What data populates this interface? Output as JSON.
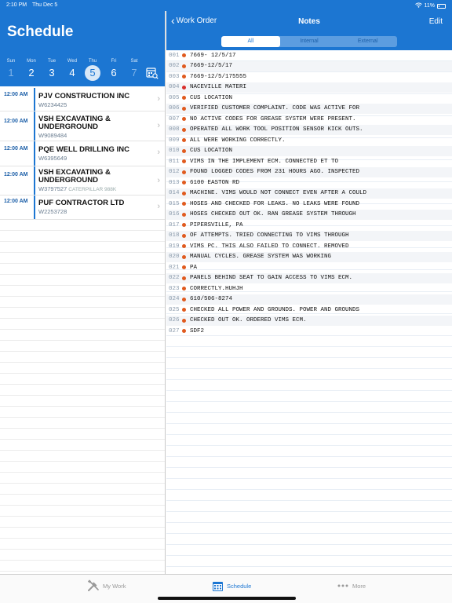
{
  "status_bar": {
    "time": "2:10 PM",
    "date": "Thu Dec 5",
    "battery": "11%"
  },
  "schedule": {
    "title": "Schedule",
    "week": {
      "days": [
        "Sun",
        "Mon",
        "Tue",
        "Wed",
        "Thu",
        "Fri",
        "Sat"
      ],
      "dates": [
        "1",
        "2",
        "3",
        "4",
        "5",
        "6",
        "7"
      ],
      "selected_index": 4
    },
    "appointments": [
      {
        "time": "12:00 AM",
        "name": "PJV CONSTRUCTION INC",
        "wo": "W6234425",
        "sub": ""
      },
      {
        "time": "12:00 AM",
        "name": "VSH EXCAVATING & UNDERGROUND",
        "wo": "W9089484",
        "sub": ""
      },
      {
        "time": "12:00 AM",
        "name": "PQE WELL DRILLING INC",
        "wo": "W6395649",
        "sub": ""
      },
      {
        "time": "12:00 AM",
        "name": "VSH EXCAVATING & UNDERGROUND",
        "wo": "W3797527",
        "sub": "CATERPILLAR 988K"
      },
      {
        "time": "12:00 AM",
        "name": "PUF CONTRACTOR LTD",
        "wo": "W2253728",
        "sub": ""
      }
    ]
  },
  "notes_header": {
    "back_label": "Work Order",
    "title": "Notes",
    "edit_label": "Edit",
    "segments": [
      "All",
      "Internal",
      "External"
    ],
    "active_segment": 0
  },
  "notes": [
    {
      "num": "001",
      "color": "#e05a1e",
      "text": "7669- 12/5/17"
    },
    {
      "num": "002",
      "color": "#e05a1e",
      "text": "7669-12/5/17"
    },
    {
      "num": "003",
      "color": "#e05a1e",
      "text": "7669-12/5/175555"
    },
    {
      "num": "004",
      "color": "#d9302c",
      "text": "NACEVILLE MATERI"
    },
    {
      "num": "005",
      "color": "#e05a1e",
      "text": "CUS LOCATION"
    },
    {
      "num": "006",
      "color": "#e05a1e",
      "text": "VERIFIED CUSTOMER COMPLAINT. CODE WAS ACTIVE FOR"
    },
    {
      "num": "007",
      "color": "#e05a1e",
      "text": "NO ACTIVE CODES FOR GREASE SYSTEM WERE PRESENT."
    },
    {
      "num": "008",
      "color": "#e05a1e",
      "text": "OPERATED ALL WORK TOOL POSITION SENSOR KICK OUTS."
    },
    {
      "num": "009",
      "color": "#e05a1e",
      "text": "ALL WERE WORKING CORRECTLY."
    },
    {
      "num": "010",
      "color": "#e05a1e",
      "text": "CUS LOCATION"
    },
    {
      "num": "011",
      "color": "#e05a1e",
      "text": "VIMS IN THE IMPLEMENT ECM. CONNECTED ET TO"
    },
    {
      "num": "012",
      "color": "#e05a1e",
      "text": "FOUND LOGGED CODES FROM 231 HOURS AGO. INSPECTED"
    },
    {
      "num": "013",
      "color": "#e05a1e",
      "text": "6100 EASTON RD"
    },
    {
      "num": "014",
      "color": "#e05a1e",
      "text": "MACHINE. VIMS WOULD NOT CONNECT EVEN AFTER A COULD"
    },
    {
      "num": "015",
      "color": "#e05a1e",
      "text": "HOSES AND CHECKED FOR LEAKS. NO LEAKS WERE FOUND"
    },
    {
      "num": "016",
      "color": "#e05a1e",
      "text": "HOSES CHECKED OUT OK. RAN GREASE SYSTEM THROUGH"
    },
    {
      "num": "017",
      "color": "#e05a1e",
      "text": "PIPERSVILLE, PA"
    },
    {
      "num": "018",
      "color": "#e05a1e",
      "text": "OF ATTEMPTS. TRIED CONNECTING TO VIMS THROUGH"
    },
    {
      "num": "019",
      "color": "#e05a1e",
      "text": "VIMS PC. THIS ALSO FAILED TO CONNECT. REMOVED"
    },
    {
      "num": "020",
      "color": "#e05a1e",
      "text": "MANUAL CYCLES. GREASE SYSTEM WAS WORKING"
    },
    {
      "num": "021",
      "color": "#e05a1e",
      "text": "PA"
    },
    {
      "num": "022",
      "color": "#e05a1e",
      "text": "PANELS BEHIND SEAT TO GAIN ACCESS TO VIMS ECM."
    },
    {
      "num": "023",
      "color": "#e05a1e",
      "text": "CORRECTLY.HUHJH"
    },
    {
      "num": "024",
      "color": "#e05a1e",
      "text": "610/506-8274"
    },
    {
      "num": "025",
      "color": "#e05a1e",
      "text": "CHECKED ALL POWER AND GROUNDS. POWER AND GROUNDS"
    },
    {
      "num": "026",
      "color": "#e05a1e",
      "text": "CHECKED OUT OK. ORDERED VIMS ECM."
    },
    {
      "num": "027",
      "color": "#e05a1e",
      "text": "SDF2"
    }
  ],
  "tab_bar": {
    "tabs": [
      {
        "label": "My Work",
        "icon": "tools-icon",
        "active": false
      },
      {
        "label": "Schedule",
        "icon": "calendar-icon",
        "active": true
      },
      {
        "label": "More",
        "icon": "more-dots-icon",
        "active": false
      }
    ]
  },
  "colors": {
    "accent": "#1c76d2",
    "note_dot": "#e05a1e",
    "note_dot_alt": "#d9302c"
  }
}
